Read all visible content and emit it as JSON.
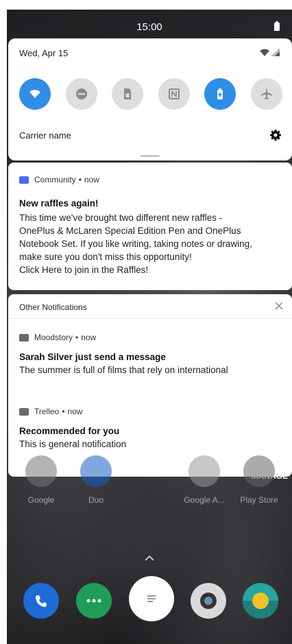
{
  "status_bar": {
    "time": "15:00"
  },
  "quick_settings": {
    "date": "Wed, Apr 15",
    "carrier": "Carrier name",
    "tiles": [
      {
        "icon": "wifi-icon",
        "active": true
      },
      {
        "icon": "do-not-disturb-icon",
        "active": false
      },
      {
        "icon": "sim-card-icon",
        "active": false
      },
      {
        "icon": "nfc-icon",
        "active": false
      },
      {
        "icon": "battery-saver-icon",
        "active": true
      },
      {
        "icon": "airplane-mode-icon",
        "active": false
      }
    ],
    "accent": "#2f8ee8"
  },
  "community_notification": {
    "app": "Community",
    "time": "now",
    "title": "New raffles again!",
    "body_lines": [
      "This time we've brought two different new raffles -",
      "OnePlus & McLaren Special Edition Pen and OnePlus",
      "Notebook Set. If you like writing, taking notes or  drawing,",
      "make sure you don't miss this opportunity!",
      "Click Here to join in the Raffles!"
    ]
  },
  "other_notifications": {
    "header": "Other Notifications",
    "items": [
      {
        "app": "Moodstory",
        "time": "now",
        "title": "Sarah Silver just send a message",
        "body": "The summer is full of films that rely on international"
      },
      {
        "app": "Trelleo",
        "time": "now",
        "title": "Recommended for you",
        "body": "This is general notification"
      }
    ]
  },
  "home": {
    "manage_label": "MANAGE",
    "apps": [
      "Google",
      "Duo",
      "Google A...",
      "Play Store"
    ]
  }
}
